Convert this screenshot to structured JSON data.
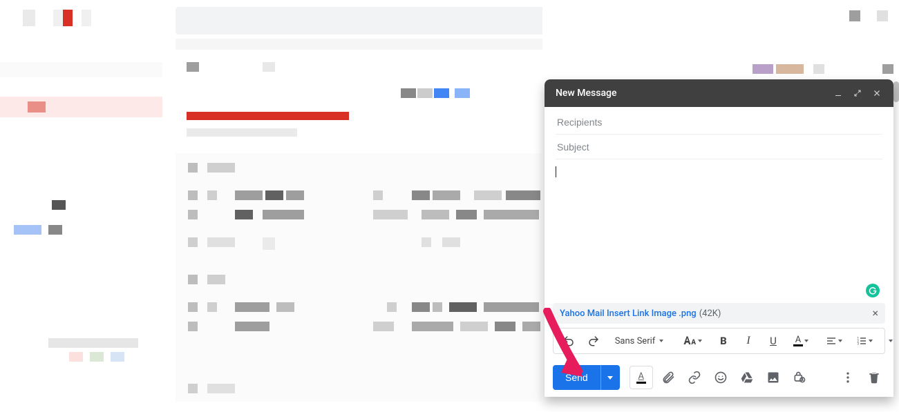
{
  "compose": {
    "title": "New Message",
    "recipients_placeholder": "Recipients",
    "subject_placeholder": "Subject",
    "attachment": {
      "name": "Yahoo Mail Insert Link Image .png",
      "size": "(42K)"
    },
    "format_toolbar": {
      "font_name": "Sans Serif"
    },
    "send_label": "Send"
  }
}
